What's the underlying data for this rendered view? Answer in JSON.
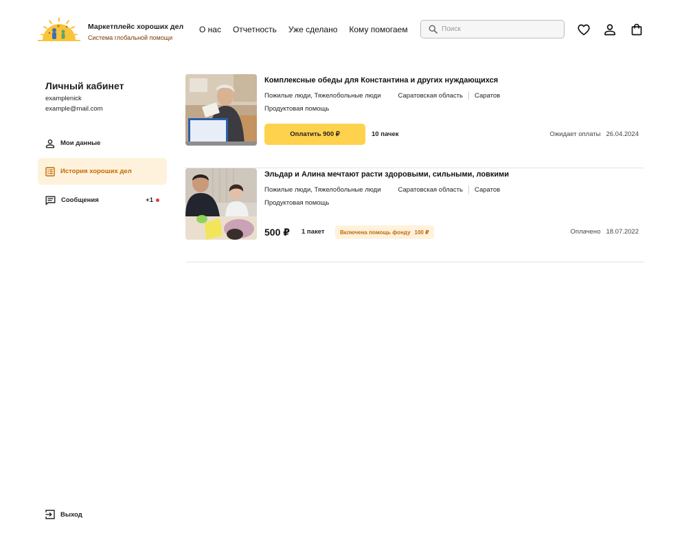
{
  "brand": {
    "title": "Маркетплейс хороших дел",
    "subtitle": "Система глобальной помощи",
    "accent": "#ffd24d"
  },
  "nav": [
    {
      "label": "О нас"
    },
    {
      "label": "Отчетность"
    },
    {
      "label": "Уже сделано"
    },
    {
      "label": "Кому помогаем"
    }
  ],
  "search": {
    "placeholder": "Поиск",
    "value": "",
    "icon": "search-icon"
  },
  "header_icons": [
    "heart-icon",
    "user-icon",
    "bag-icon"
  ],
  "profile": {
    "title": "Личный кабинет",
    "nick": "examplenick",
    "email": "example@mail.com"
  },
  "menu": [
    {
      "label": "Мои данные",
      "icon": "user-icon",
      "active": false
    },
    {
      "label": "История хороших дел",
      "icon": "list-icon",
      "active": true
    },
    {
      "label": "Сообщения",
      "icon": "chat-icon",
      "active": false,
      "badge": "+1"
    }
  ],
  "logout": {
    "label": "Выход",
    "icon": "logout-icon"
  },
  "cards": [
    {
      "title": "Комплексные обеды для Константина и других нуждающихся",
      "tags": [
        "Пожилые люди, Тяжелобольные люди",
        "Саратовская область",
        "Саратов"
      ],
      "category": "Продуктовая помощь",
      "pay_label": "Оплатить 900 ₽",
      "quantity": "10 пачек",
      "status": "Ожидает оплаты",
      "date": "26.04.2024"
    },
    {
      "title": "Эльдар и Алина мечтают расти здоровыми, сильными, ловкими",
      "tags": [
        "Пожилые люди, Тяжелобольные люди",
        "Саратовская область",
        "Саратов"
      ],
      "category": "Продуктовая помощь",
      "price": "500 ₽",
      "quantity": "1 пакет",
      "fund_label": "Включена помощь фонду",
      "fund_amount": "100 ₽",
      "status": "Оплачено",
      "date": "18.07.2022"
    }
  ]
}
